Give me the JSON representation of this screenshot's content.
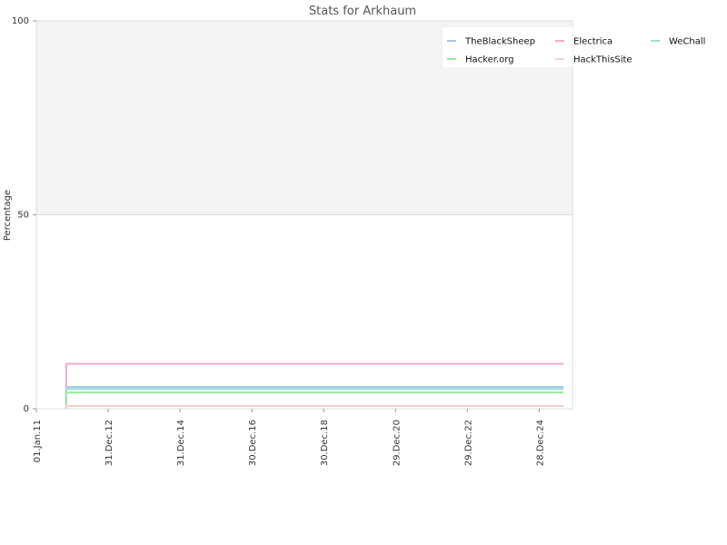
{
  "chart_data": {
    "type": "line",
    "title": "Stats for Arkhaum",
    "xlabel": "",
    "ylabel": "Percentage",
    "ylim": [
      0,
      100
    ],
    "yticks": [
      0,
      50,
      100
    ],
    "xlim": [
      "2011-01-01",
      "2025-12-01"
    ],
    "xticks": [
      {
        "date": "2011-01-01",
        "label": "01.Jan.11"
      },
      {
        "date": "2012-12-31",
        "label": "31.Dec.12"
      },
      {
        "date": "2014-12-31",
        "label": "31.Dec.14"
      },
      {
        "date": "2016-12-30",
        "label": "30.Dec.16"
      },
      {
        "date": "2018-12-30",
        "label": "30.Dec.18"
      },
      {
        "date": "2020-12-29",
        "label": "29.Dec.20"
      },
      {
        "date": "2022-12-29",
        "label": "29.Dec.22"
      },
      {
        "date": "2024-12-28",
        "label": "28.Dec.24"
      }
    ],
    "grid": true,
    "legend_position": "top-right",
    "series": [
      {
        "name": "TheBlackSheep",
        "color": "#9ec6ee",
        "points": [
          {
            "x": "2011-11-01",
            "y": 0
          },
          {
            "x": "2011-11-01",
            "y": 5.6
          },
          {
            "x": "2025-09-01",
            "y": 5.6
          }
        ]
      },
      {
        "name": "Electrica",
        "color": "#f2a7cf",
        "points": [
          {
            "x": "2011-11-01",
            "y": 0
          },
          {
            "x": "2011-11-01",
            "y": 11.6
          },
          {
            "x": "2025-09-01",
            "y": 11.6
          }
        ]
      },
      {
        "name": "WeChall",
        "color": "#99e2d4",
        "points": [
          {
            "x": "2011-11-01",
            "y": 0
          },
          {
            "x": "2011-11-01",
            "y": 5.1
          },
          {
            "x": "2025-09-01",
            "y": 5.1
          }
        ]
      },
      {
        "name": "Hacker.org",
        "color": "#9be79b",
        "points": [
          {
            "x": "2011-11-01",
            "y": 0
          },
          {
            "x": "2011-11-01",
            "y": 4.2
          },
          {
            "x": "2025-09-01",
            "y": 4.2
          }
        ]
      },
      {
        "name": "HackThisSite",
        "color": "#f0d2c7",
        "points": [
          {
            "x": "2011-11-01",
            "y": 0
          },
          {
            "x": "2011-11-01",
            "y": 0.7
          },
          {
            "x": "2025-09-01",
            "y": 0.7
          }
        ]
      }
    ]
  }
}
